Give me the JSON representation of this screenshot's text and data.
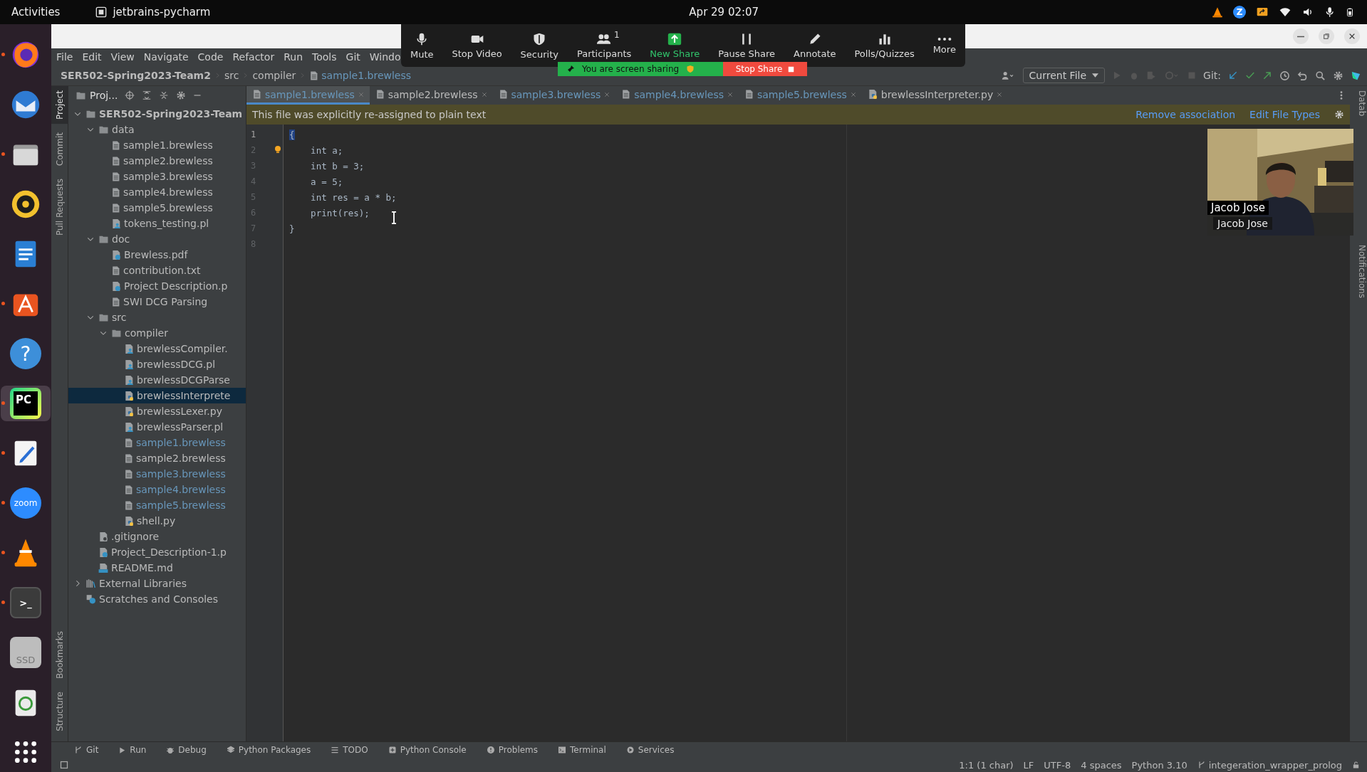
{
  "top_bar": {
    "activities": "Activities",
    "app": "jetbrains-pycharm",
    "clock": "Apr 29  02:07"
  },
  "tray": [
    {
      "kind": "cone"
    },
    {
      "kind": "zcircle",
      "label": "Z"
    },
    {
      "kind": "share"
    },
    {
      "kind": "wifi"
    },
    {
      "kind": "volume"
    },
    {
      "kind": "mic"
    },
    {
      "kind": "battery"
    }
  ],
  "dock": [
    {
      "kind": "firefox",
      "running": true,
      "selected": false
    },
    {
      "kind": "mail",
      "running": false,
      "selected": false
    },
    {
      "kind": "files",
      "running": true,
      "selected": false
    },
    {
      "kind": "music",
      "running": false,
      "selected": false
    },
    {
      "kind": "writer",
      "running": false,
      "selected": false
    },
    {
      "kind": "store",
      "running": true,
      "selected": false
    },
    {
      "kind": "help",
      "label": "?",
      "running": false,
      "selected": false
    },
    {
      "kind": "pycharm",
      "label": "PC",
      "running": true,
      "selected": true
    },
    {
      "kind": "editor",
      "running": true,
      "selected": false
    },
    {
      "kind": "zoom",
      "label": "zoom",
      "running": true,
      "selected": false
    },
    {
      "kind": "cone",
      "running": true,
      "selected": false
    },
    {
      "kind": "terminal",
      "label": ">_",
      "running": true,
      "selected": false
    },
    {
      "kind": "disk",
      "label": "SSD",
      "running": false,
      "selected": false
    },
    {
      "kind": "trash",
      "running": false,
      "selected": false
    },
    {
      "kind": "grid",
      "running": false,
      "selected": false
    }
  ],
  "zoom_toolbar": [
    {
      "kind": "mic",
      "label": "Mute"
    },
    {
      "kind": "camera",
      "label": "Stop Video"
    },
    {
      "kind": "shield",
      "label": "Security"
    },
    {
      "kind": "people",
      "label": "Participants",
      "count": "1"
    },
    {
      "kind": "share",
      "label": "New Share"
    },
    {
      "kind": "pause",
      "label": "Pause Share"
    },
    {
      "kind": "pen",
      "label": "Annotate"
    },
    {
      "kind": "chart",
      "label": "Polls/Quizzes"
    },
    {
      "kind": "dots",
      "label": "More"
    }
  ],
  "sharing": {
    "status": "You are screen sharing",
    "stop": "Stop Share"
  },
  "menu": [
    "File",
    "Edit",
    "View",
    "Navigate",
    "Code",
    "Refactor",
    "Run",
    "Tools",
    "Git",
    "Windo"
  ],
  "breadcrumb": [
    "SER502-Spring2023-Team2",
    "src",
    "compiler",
    "sample1.brewless"
  ],
  "toolbar": {
    "run_config": "Current File",
    "git_label": "Git:"
  },
  "project_panel": {
    "title": "Proj...",
    "tree": [
      {
        "name": "SER502-Spring2023-Team",
        "kind": "folder",
        "expanded": true,
        "selected": false,
        "changed": false,
        "children": [
          {
            "name": "data",
            "kind": "folder",
            "expanded": true,
            "selected": false,
            "changed": false,
            "children": [
              {
                "name": "sample1.brewless",
                "kind": "text",
                "selected": false,
                "changed": false
              },
              {
                "name": "sample2.brewless",
                "kind": "text",
                "selected": false,
                "changed": false
              },
              {
                "name": "sample3.brewless",
                "kind": "text",
                "selected": false,
                "changed": false
              },
              {
                "name": "sample4.brewless",
                "kind": "text",
                "selected": false,
                "changed": false
              },
              {
                "name": "sample5.brewless",
                "kind": "text",
                "selected": false,
                "changed": false
              },
              {
                "name": "tokens_testing.pl",
                "kind": "prolog",
                "selected": false,
                "changed": false
              }
            ]
          },
          {
            "name": "doc",
            "kind": "folder",
            "expanded": true,
            "selected": false,
            "changed": false,
            "children": [
              {
                "name": "Brewless.pdf",
                "kind": "unknown",
                "selected": false,
                "changed": false
              },
              {
                "name": "contribution.txt",
                "kind": "text",
                "selected": false,
                "changed": false
              },
              {
                "name": "Project Description.p",
                "kind": "unknown",
                "selected": false,
                "changed": false
              },
              {
                "name": "SWI DCG Parsing",
                "kind": "text",
                "selected": false,
                "changed": false
              }
            ]
          },
          {
            "name": "src",
            "kind": "folder",
            "expanded": true,
            "selected": false,
            "changed": false,
            "children": [
              {
                "name": "compiler",
                "kind": "folder",
                "expanded": true,
                "selected": false,
                "changed": false,
                "children": [
                  {
                    "name": "brewlessCompiler.",
                    "kind": "prolog",
                    "selected": false,
                    "changed": false
                  },
                  {
                    "name": "brewlessDCG.pl",
                    "kind": "prolog",
                    "selected": false,
                    "changed": false
                  },
                  {
                    "name": "brewlessDCGParse",
                    "kind": "prolog",
                    "selected": false,
                    "changed": false
                  },
                  {
                    "name": "brewlessInterprete",
                    "kind": "python",
                    "selected": true,
                    "changed": false
                  },
                  {
                    "name": "brewlessLexer.py",
                    "kind": "python",
                    "selected": false,
                    "changed": false
                  },
                  {
                    "name": "brewlessParser.pl",
                    "kind": "prolog",
                    "selected": false,
                    "changed": false
                  },
                  {
                    "name": "sample1.brewless",
                    "kind": "text",
                    "selected": false,
                    "changed": true
                  },
                  {
                    "name": "sample2.brewless",
                    "kind": "text",
                    "selected": false,
                    "changed": false
                  },
                  {
                    "name": "sample3.brewless",
                    "kind": "text",
                    "selected": false,
                    "changed": true
                  },
                  {
                    "name": "sample4.brewless",
                    "kind": "text",
                    "selected": false,
                    "changed": true
                  },
                  {
                    "name": "sample5.brewless",
                    "kind": "text",
                    "selected": false,
                    "changed": true
                  },
                  {
                    "name": "shell.py",
                    "kind": "python",
                    "selected": false,
                    "changed": false
                  }
                ]
              }
            ]
          },
          {
            "name": ".gitignore",
            "kind": "ignore",
            "selected": false,
            "changed": false
          },
          {
            "name": "Project_Description-1.p",
            "kind": "unknown",
            "selected": false,
            "changed": false
          },
          {
            "name": "README.md",
            "kind": "markdown",
            "selected": false,
            "changed": false
          }
        ]
      },
      {
        "name": "External Libraries",
        "kind": "library",
        "expanded": false,
        "selected": false,
        "changed": false
      },
      {
        "name": "Scratches and Consoles",
        "kind": "scratch",
        "selected": false,
        "changed": false
      }
    ]
  },
  "editor_tabs": [
    {
      "label": "sample1.brewless",
      "kind": "text",
      "selected": true,
      "changed": true
    },
    {
      "label": "sample2.brewless",
      "kind": "text",
      "selected": false,
      "changed": false
    },
    {
      "label": "sample3.brewless",
      "kind": "text",
      "selected": false,
      "changed": true
    },
    {
      "label": "sample4.brewless",
      "kind": "text",
      "selected": false,
      "changed": true
    },
    {
      "label": "sample5.brewless",
      "kind": "text",
      "selected": false,
      "changed": true
    },
    {
      "label": "brewlessInterpreter.py",
      "kind": "python",
      "selected": false,
      "changed": false
    }
  ],
  "notice": {
    "text": "This file was explicitly re-assigned to plain text",
    "actions": [
      "Remove association",
      "Edit File Types"
    ]
  },
  "editor": {
    "lines": [
      {
        "number": "1",
        "code": "{",
        "bulb": false
      },
      {
        "number": "2",
        "code": "    int a;",
        "bulb": true
      },
      {
        "number": "3",
        "code": "    int b = 3;",
        "bulb": false
      },
      {
        "number": "4",
        "code": "    a = 5;",
        "bulb": false
      },
      {
        "number": "5",
        "code": "    int res = a * b;",
        "bulb": false
      },
      {
        "number": "6",
        "code": "    print(res);",
        "bulb": false
      },
      {
        "number": "7",
        "code": "}",
        "bulb": false
      },
      {
        "number": "8",
        "bulb": false
      }
    ]
  },
  "video": {
    "name_tag": "Jacob Jose",
    "caption": "Jacob Jose"
  },
  "left_strip": [
    {
      "label": "Project",
      "selected": true
    },
    {
      "label": "Commit",
      "selected": false
    },
    {
      "label": "Pull Requests",
      "selected": false
    }
  ],
  "left_strip_bottom": [
    {
      "label": "Bookmarks",
      "selected": false
    },
    {
      "label": "Structure",
      "selected": false
    }
  ],
  "right_strip": [
    "Datab",
    "Notifications"
  ],
  "tool_windows": [
    {
      "kind": "branch",
      "label": "Git"
    },
    {
      "kind": "play",
      "label": "Run"
    },
    {
      "kind": "bug",
      "label": "Debug"
    },
    {
      "kind": "layers",
      "label": "Python Packages"
    },
    {
      "kind": "list",
      "label": "TODO"
    },
    {
      "kind": "console",
      "label": "Python Console"
    },
    {
      "kind": "alert",
      "label": "Problems"
    },
    {
      "kind": "terminal",
      "label": "Terminal"
    },
    {
      "kind": "services",
      "label": "Services"
    }
  ],
  "status": [
    "1:1 (1 char)",
    "LF",
    "UTF-8",
    "4 spaces",
    "Python 3.10"
  ],
  "branch": "integeration_wrapper_prolog"
}
